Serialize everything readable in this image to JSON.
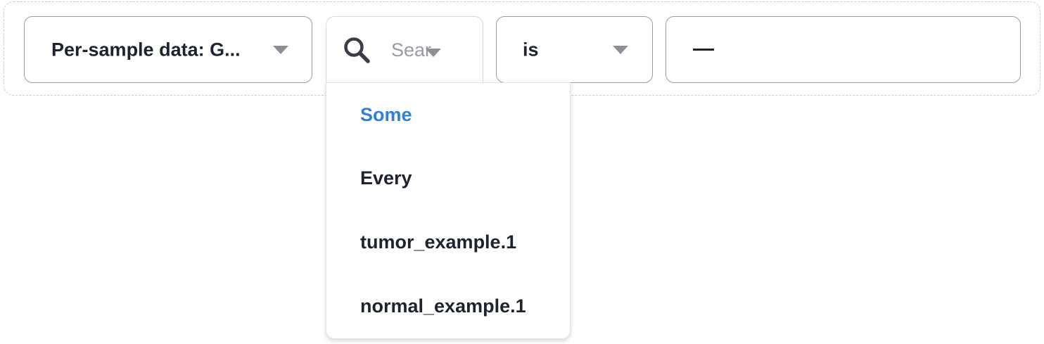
{
  "filter": {
    "field_label": "Per-sample data: G...",
    "quantifier_placeholder": "Sear",
    "operator_label": "is",
    "value": "—"
  },
  "dropdown": {
    "options": [
      {
        "label": "Some",
        "selected": true
      },
      {
        "label": "Every",
        "selected": false
      },
      {
        "label": "tumor_example.1",
        "selected": false
      },
      {
        "label": "normal_example.1",
        "selected": false
      }
    ]
  },
  "colors": {
    "accent": "#2f80d9",
    "text": "#1d2330",
    "muted": "#9a9aa6",
    "border": "#9a9aa6"
  },
  "icons": {
    "search": "search-icon",
    "caret": "chevron-down-icon"
  }
}
